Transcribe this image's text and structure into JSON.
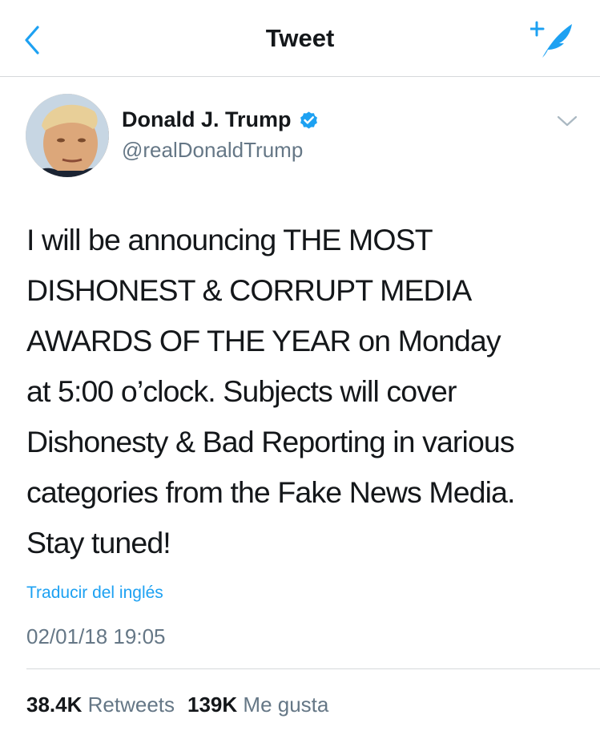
{
  "navbar": {
    "title": "Tweet",
    "back_icon": "chevron-left-icon",
    "compose_icon": "compose-feather-icon"
  },
  "author": {
    "name": "Donald J. Trump",
    "handle": "@realDonaldTrump",
    "verified": true
  },
  "tweet": {
    "text": "I will be announcing THE MOST\nDISHONEST & CORRUPT MEDIA\nAWARDS OF THE YEAR on Monday\nat 5:00 o’clock. Subjects will cover\nDishonesty & Bad Reporting in various\ncategories from the Fake News Media.\nStay tuned!",
    "translate_label": "Traducir del inglés",
    "timestamp": "02/01/18 19:05"
  },
  "stats": {
    "retweets_count": "38.4K",
    "retweets_label": "Retweets",
    "likes_count": "139K",
    "likes_label": "Me gusta"
  },
  "colors": {
    "accent": "#1da1f2",
    "secondary_text": "#657786",
    "primary_text": "#14171a",
    "divider": "#d6d9db"
  }
}
